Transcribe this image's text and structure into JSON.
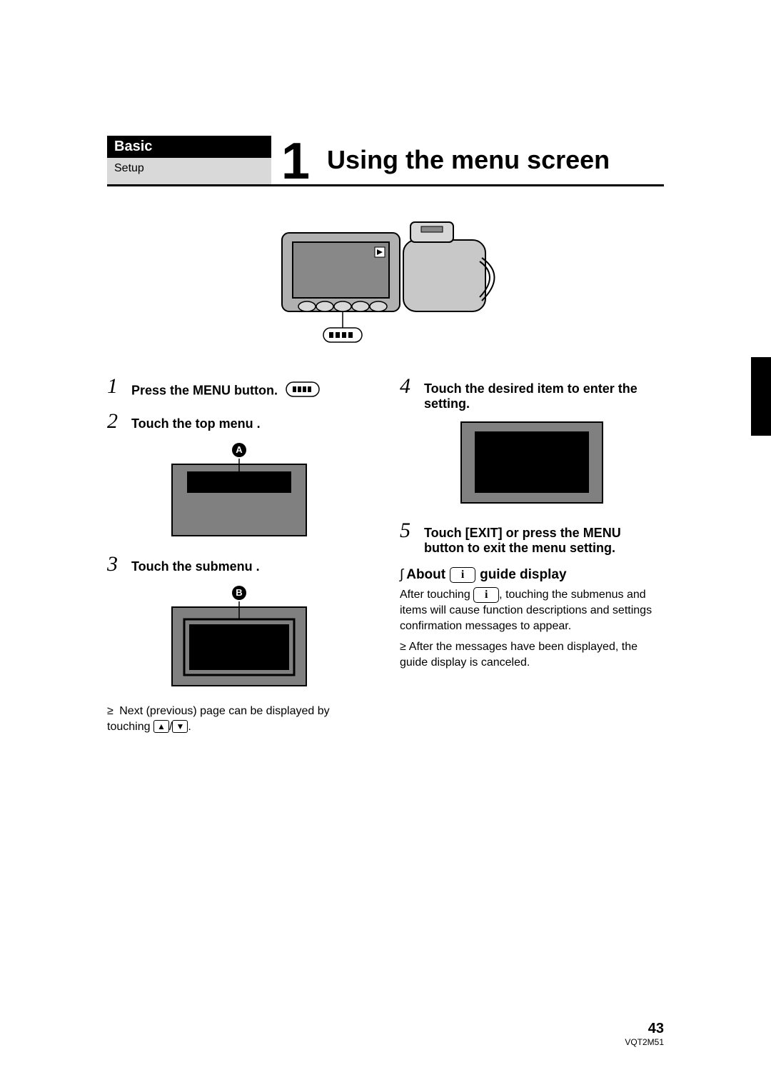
{
  "header": {
    "category": "Basic",
    "subcategory": "Setup",
    "chapter_number": "1",
    "title": "Using the menu screen"
  },
  "callouts": {
    "a": "A",
    "b": "B"
  },
  "steps": {
    "s1": {
      "num": "1",
      "text": "Press the MENU button."
    },
    "s2": {
      "num": "2",
      "text": "Touch the top menu ."
    },
    "s3": {
      "num": "3",
      "text": "Touch the submenu ."
    },
    "s3_note": "Next (previous) page can be displayed by touching ",
    "s3_note_tail": ".",
    "s4": {
      "num": "4",
      "text": "Touch the desired item to enter the setting."
    },
    "s5": {
      "num": "5",
      "text": "Touch [EXIT] or press the MENU button to exit the menu setting."
    }
  },
  "guide": {
    "heading_prefix": "About",
    "heading_suffix": "guide display",
    "body": "After touching ",
    "body_tail": ", touching the submenus and items will cause function descriptions and settings confirmation messages to appear.",
    "note": "After the messages have been displayed, the guide display is canceled."
  },
  "arrows": {
    "up": "▲",
    "down": "▼",
    "sep": "/"
  },
  "info_glyph": "i",
  "footer": {
    "page": "43",
    "code": "VQT2M51"
  }
}
